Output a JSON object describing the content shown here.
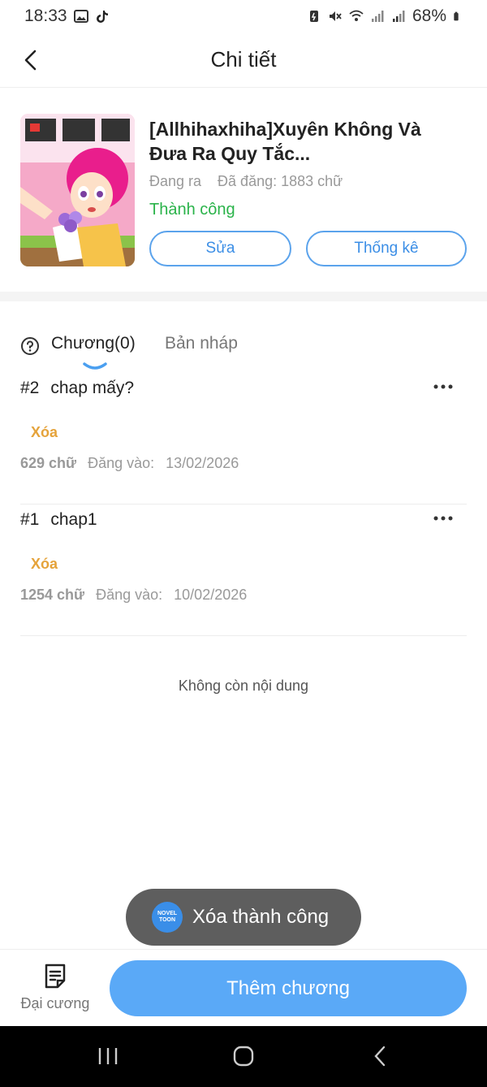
{
  "status_bar": {
    "time": "18:33",
    "battery": "68%"
  },
  "header": {
    "title": "Chi tiết"
  },
  "book": {
    "title": "[Allhihaxhiha]Xuyên Không Và Đưa Ra Quy Tắc...",
    "state": "Đang ra",
    "word_count": "Đã đăng: 1883 chữ",
    "status": "Thành công",
    "edit_label": "Sửa",
    "stats_label": "Thống kê"
  },
  "tabs": {
    "chapters": "Chương(0)",
    "drafts": "Bản nháp"
  },
  "chapters": [
    {
      "number": "#2",
      "title": "chap mấy?",
      "status": "Xóa",
      "words": "629 chữ",
      "posted_label": "Đăng vào:",
      "date": "13/02/2026"
    },
    {
      "number": "#1",
      "title": "chap1",
      "status": "Xóa",
      "words": "1254 chữ",
      "posted_label": "Đăng vào:",
      "date": "10/02/2026"
    }
  ],
  "list_end": "Không còn nội dung",
  "toast": {
    "logo_line1": "NOVEL",
    "logo_line2": "TOON",
    "message": "Xóa thành công"
  },
  "bottom": {
    "outline_label": "Đại cương",
    "add_chapter_label": "Thêm chương"
  },
  "colors": {
    "accent": "#5aa9f7",
    "success": "#2ab34a",
    "warning": "#e5a33b"
  }
}
